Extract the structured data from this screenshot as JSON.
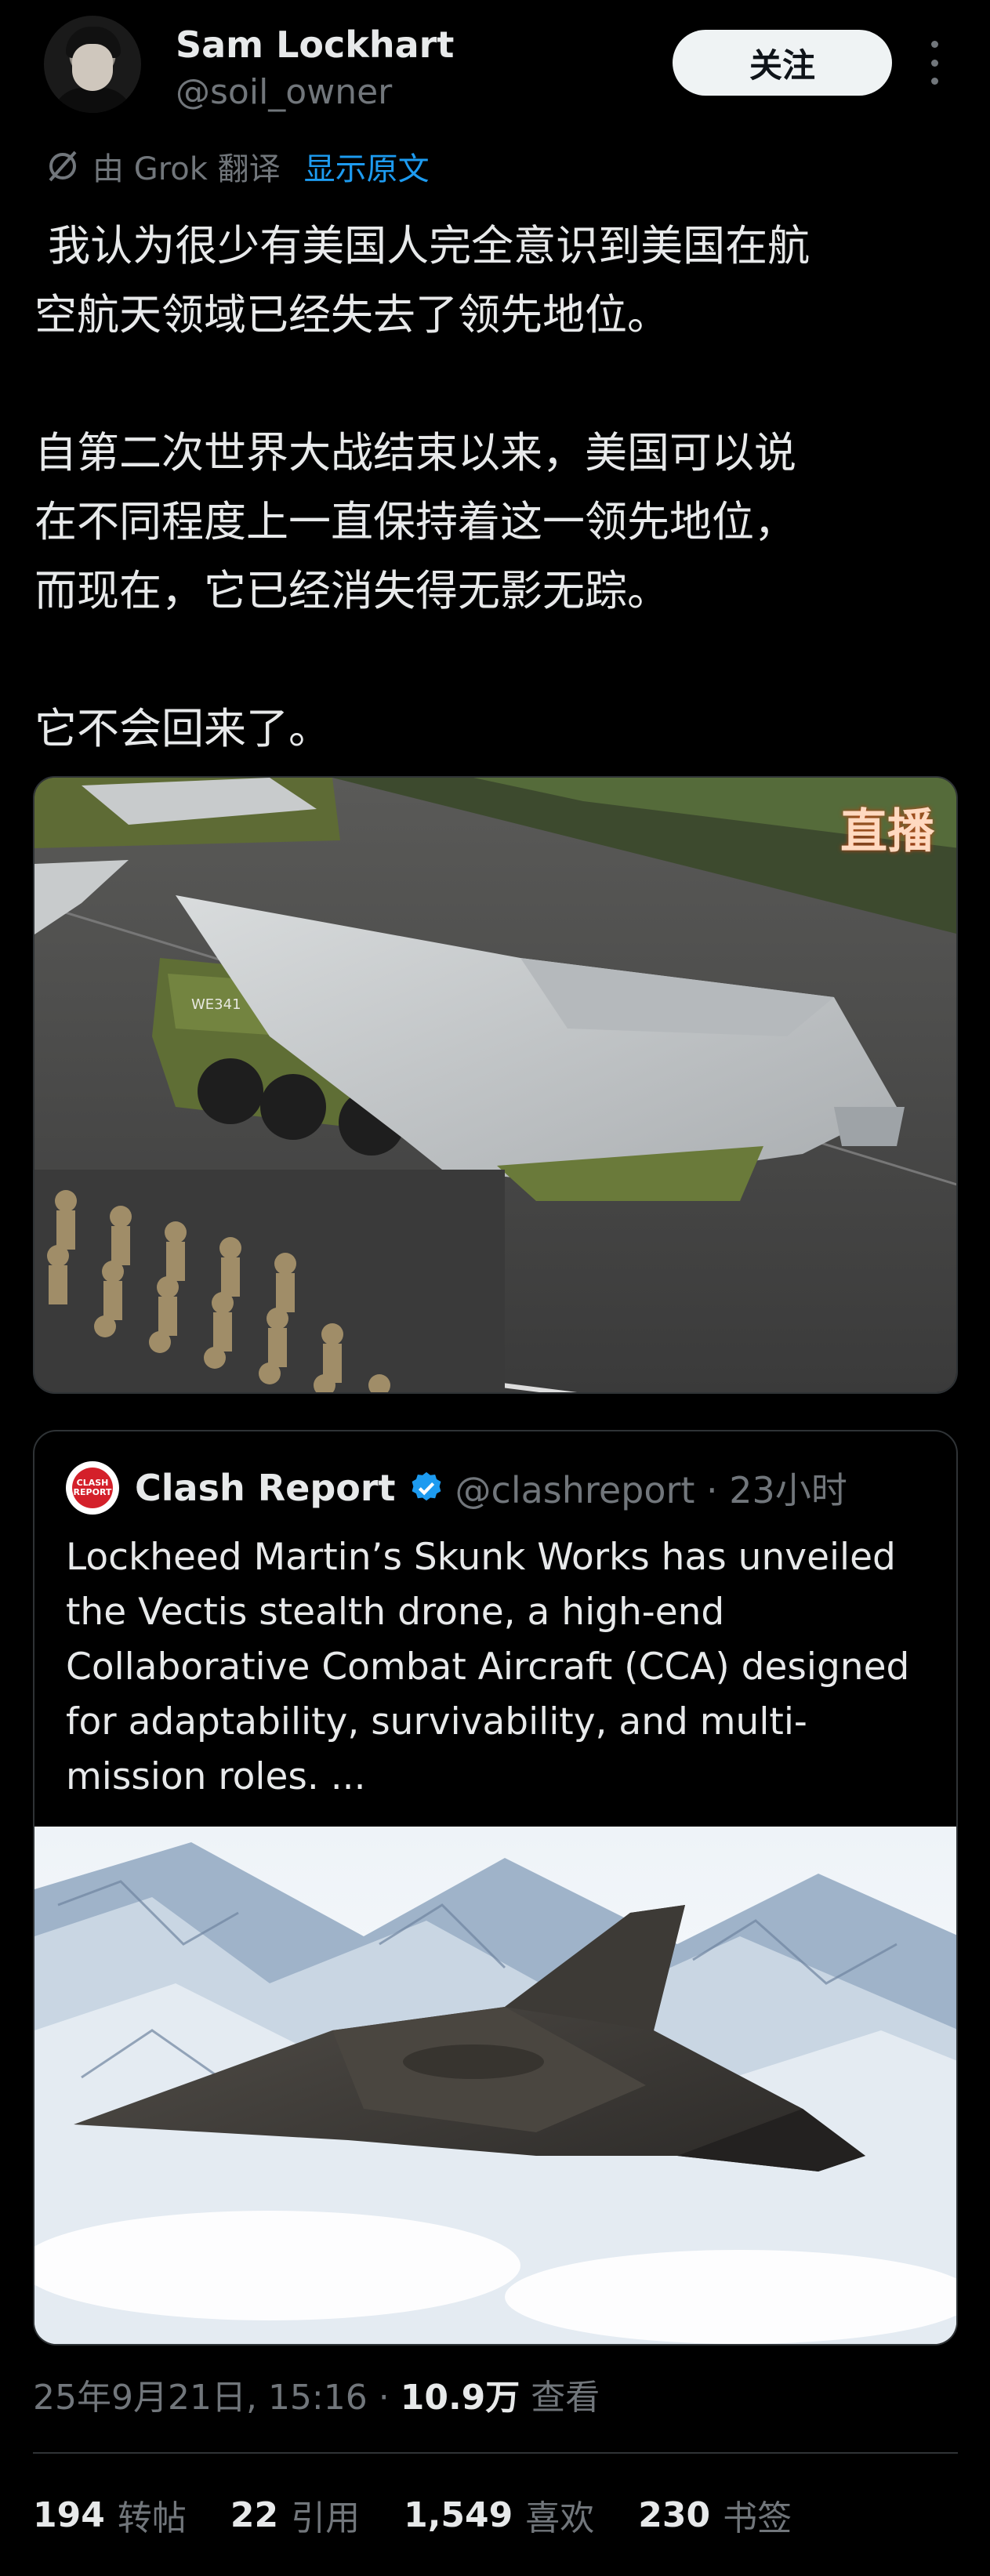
{
  "author": {
    "display_name": "Sam Lockhart",
    "handle": "@soil_owner"
  },
  "follow_label": "关注",
  "translation": {
    "by_label": "由 Grok 翻译",
    "show_original": "显示原文"
  },
  "tweet_text": " 我认为很少有美国人完全意识到美国在航\n空航天领域已经失去了领先地位。\n\n自第二次世界大战结束以来，美国可以说\n在不同程度上一直保持着这一领先地位，\n而现在，它已经消失得无影无踪。\n\n它不会回来了。",
  "media1": {
    "live_tag": "直播",
    "truck_plate": "WE341"
  },
  "quote": {
    "avatar_text": "CLASH REPORT",
    "name": "Clash Report",
    "handle_time": "@clashreport · 23小时",
    "text": "Lockheed Martin’s Skunk Works has unveiled the Vectis stealth drone, a high-end Collaborative Combat Aircraft (CCA) designed for adaptability, survivability, and multi-mission roles. ..."
  },
  "meta": {
    "date": "25年9月21日, 15:16 ·",
    "views": "10.9万",
    "views_label": "查看"
  },
  "stats": [
    {
      "num": "194",
      "label": "转帖"
    },
    {
      "num": "22",
      "label": "引用"
    },
    {
      "num": "1,549",
      "label": "喜欢"
    },
    {
      "num": "230",
      "label": "书签"
    }
  ],
  "colors": {
    "background": "#000000",
    "text": "#e7e9ea",
    "muted": "#71767b",
    "link": "#1d9bf0",
    "border": "#2f3336"
  }
}
